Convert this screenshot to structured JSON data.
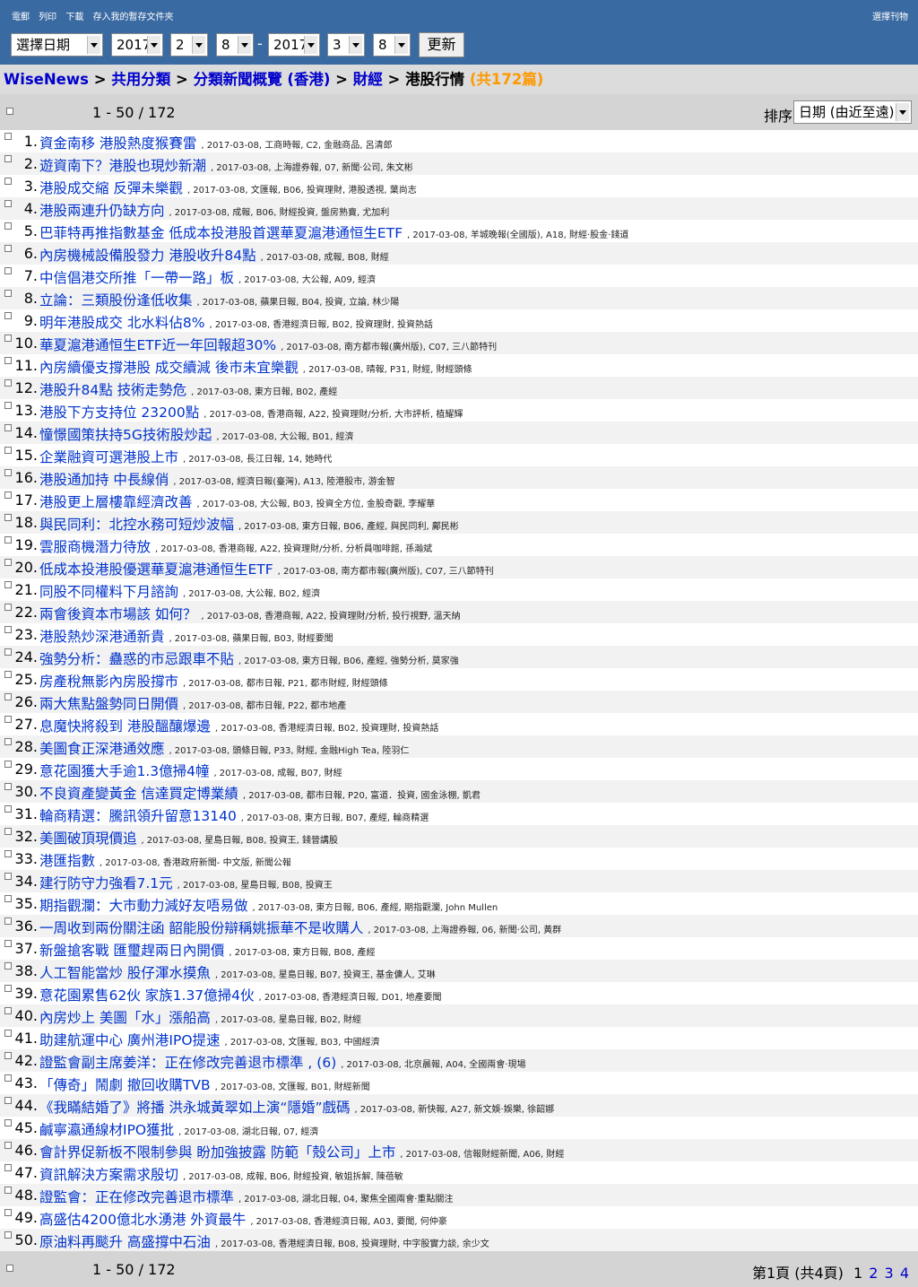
{
  "toolbar": {
    "links": [
      "電郵",
      "列印",
      "下載",
      "存入我的暫存文件夾"
    ],
    "publication_select": "選擇刊物",
    "date_mode": "選擇日期",
    "from": {
      "year": "2017",
      "month": "2",
      "day": "8"
    },
    "separator": "-",
    "to": {
      "year": "2017",
      "month": "3",
      "day": "8"
    },
    "refresh_label": "更新"
  },
  "breadcrumb": {
    "home": "WiseNews",
    "sep": ">",
    "items": [
      "共用分類",
      "分類新聞概覽 (香港)",
      "財經"
    ],
    "current": "港股行情",
    "count": "(共172篇)"
  },
  "list_header": {
    "range": "1 - 50 / 172",
    "sort_label": "排序",
    "sort_value": "日期 (由近至遠)"
  },
  "articles": [
    {
      "num": "1.",
      "title": "資金南移 港股熱度猴賽雷",
      "meta": ", 2017-03-08, 工商時報, C2, 金融商品, 呂清郎"
    },
    {
      "num": "2.",
      "title": "遊資南下？港股也現炒新潮",
      "meta": ", 2017-03-08, 上海證券報, 07, 新聞·公司, 朱文彬"
    },
    {
      "num": "3.",
      "title": "港股成交縮 反彈未樂觀",
      "meta": ", 2017-03-08, 文匯報, B06, 投資理財, 港股透視, 葉尚志"
    },
    {
      "num": "4.",
      "title": "港股兩連升仍缺方向",
      "meta": ", 2017-03-08, 成報, B06, 財經投資, 盤房熟賣, 尤加利"
    },
    {
      "num": "5.",
      "title": "巴菲特再推指數基金 低成本投港股首選華夏滬港通恒生ETF",
      "meta": ", 2017-03-08, 羊城晚報(全國版), A18, 財經·股金·錢道"
    },
    {
      "num": "6.",
      "title": "內房機械設備股發力 港股收升84點",
      "meta": ", 2017-03-08, 成報, B08, 財經"
    },
    {
      "num": "7.",
      "title": "中信倡港交所推「一帶一路」板",
      "meta": ", 2017-03-08, 大公報, A09, 經濟"
    },
    {
      "num": "8.",
      "title": "立論：三類股份逢低收集",
      "meta": ", 2017-03-08, 蘋果日報, B04, 投資, 立論, 林少陽"
    },
    {
      "num": "9.",
      "title": "明年港股成交 北水料佔8%",
      "meta": ", 2017-03-08, 香港經濟日報, B02, 投資理財, 投資熱話"
    },
    {
      "num": "10.",
      "title": "華夏滬港通恒生ETF近一年回報超30%",
      "meta": ", 2017-03-08, 南方都市報(廣州版), C07, 三八節特刊"
    },
    {
      "num": "11.",
      "title": "內房續優支撐港股 成交續減 後市未宜樂觀",
      "meta": ", 2017-03-08, 晴報, P31, 財經, 財經頭條"
    },
    {
      "num": "12.",
      "title": "港股升84點 技術走勢危",
      "meta": ", 2017-03-08, 東方日報, B02, 產經"
    },
    {
      "num": "13.",
      "title": "港股下方支持位 23200點",
      "meta": ", 2017-03-08, 香港商報, A22, 投資理財/分析, 大市評析, 植耀輝"
    },
    {
      "num": "14.",
      "title": "憧憬國策扶持5G技術股炒起",
      "meta": ", 2017-03-08, 大公報, B01, 經濟"
    },
    {
      "num": "15.",
      "title": "企業融資可選港股上市",
      "meta": ", 2017-03-08, 長江日報, 14, 她時代"
    },
    {
      "num": "16.",
      "title": "港股通加持 中長線俏",
      "meta": ", 2017-03-08, 經濟日報(臺灣), A13, 陸港股市, 游金智"
    },
    {
      "num": "17.",
      "title": "港股更上層樓靠經濟改善",
      "meta": ", 2017-03-08, 大公報, B03, 投資全方位, 金股奇觀, 李耀華"
    },
    {
      "num": "18.",
      "title": "與民同利：北控水務可短炒波幅",
      "meta": ", 2017-03-08, 東方日報, B06, 產經, 與民同利, 鄺民彬"
    },
    {
      "num": "19.",
      "title": "雲服商機潛力待放",
      "meta": ", 2017-03-08, 香港商報, A22, 投資理財/分析, 分析員咖啡館, 孫瀚斌"
    },
    {
      "num": "20.",
      "title": "低成本投港股優選華夏滬港通恒生ETF",
      "meta": ", 2017-03-08, 南方都市報(廣州版), C07, 三八節特刊"
    },
    {
      "num": "21.",
      "title": "同股不同權料下月諮詢",
      "meta": ", 2017-03-08, 大公報, B02, 經濟"
    },
    {
      "num": "22.",
      "title": "兩會後資本市場該 如何？",
      "meta": ", 2017-03-08, 香港商報, A22, 投資理財/分析, 投行視野, 溫天納"
    },
    {
      "num": "23.",
      "title": "港股熱炒深港通新貴",
      "meta": ", 2017-03-08, 蘋果日報, B03, 財經要聞"
    },
    {
      "num": "24.",
      "title": "強勢分析：蠱惑的市忌跟車不貼",
      "meta": ", 2017-03-08, 東方日報, B06, 產經, 強勢分析, 莫家強"
    },
    {
      "num": "25.",
      "title": "房產稅無影內房股撐市",
      "meta": ", 2017-03-08, 都市日報, P21, 都市財經, 財經頭條"
    },
    {
      "num": "26.",
      "title": "兩大焦點盤勢同日開價",
      "meta": ", 2017-03-08, 都市日報, P22, 都市地產"
    },
    {
      "num": "27.",
      "title": "息魔快將殺到 港股醞釀爆邊",
      "meta": ", 2017-03-08, 香港經濟日報, B02, 投資理財, 投資熱話"
    },
    {
      "num": "28.",
      "title": "美圖食正深港通效應",
      "meta": ", 2017-03-08, 頭條日報, P33, 財經, 金融High Tea, 陸羽仁"
    },
    {
      "num": "29.",
      "title": "意花園獲大手逾1.3億掃4幢",
      "meta": ", 2017-03-08, 成報, B07, 財經"
    },
    {
      "num": "30.",
      "title": "不良資產變黃金 信達買定博業績",
      "meta": ", 2017-03-08, 都市日報, P20, 富道．投資, 國金泳棚, 凱君"
    },
    {
      "num": "31.",
      "title": "輪商精選：騰訊領升留意13140",
      "meta": ", 2017-03-08, 東方日報, B07, 產經, 輪商精選"
    },
    {
      "num": "32.",
      "title": "美圖破頂現價追",
      "meta": ", 2017-03-08, 星島日報, B08, 投資王, 錢晉講股"
    },
    {
      "num": "33.",
      "title": "港匯指數",
      "meta": ", 2017-03-08, 香港政府新聞- 中文版, 新聞公報"
    },
    {
      "num": "34.",
      "title": "建行防守力強看7.1元",
      "meta": ", 2017-03-08, 星島日報, B08, 投資王"
    },
    {
      "num": "35.",
      "title": "期指觀瀾：大市動力減好友唔易做",
      "meta": ", 2017-03-08, 東方日報, B06, 產經, 期指觀瀾, John Mullen"
    },
    {
      "num": "36.",
      "title": "一周收到兩份關注函 韶能股份辯稱姚振華不是收購人",
      "meta": ", 2017-03-08, 上海證券報, 06, 新聞·公司, 黃群"
    },
    {
      "num": "37.",
      "title": "新盤搶客戰 匯璽趕兩日內開價",
      "meta": ", 2017-03-08, 東方日報, B08, 產經"
    },
    {
      "num": "38.",
      "title": "人工智能當炒 股仔渾水摸魚",
      "meta": ", 2017-03-08, 星島日報, B07, 投資王, 基金傭人, 艾琳"
    },
    {
      "num": "39.",
      "title": "意花園累售62伙 家族1.37億掃4伙",
      "meta": ", 2017-03-08, 香港經濟日報, D01, 地產要聞"
    },
    {
      "num": "40.",
      "title": "內房炒上 美圖「水」漲船高",
      "meta": ", 2017-03-08, 星島日報, B02, 財經"
    },
    {
      "num": "41.",
      "title": "助建航運中心 廣州港IPO提速",
      "meta": ", 2017-03-08, 文匯報, B03, 中國經濟"
    },
    {
      "num": "42.",
      "title": "證監會副主席姜洋：正在修改完善退市標準 , (6)",
      "meta": ", 2017-03-08, 北京晨報, A04, 全國兩會·現場"
    },
    {
      "num": "43.",
      "title": "「傳奇」鬧劇 撤回收購TVB",
      "meta": ", 2017-03-08, 文匯報, B01, 財經新聞"
    },
    {
      "num": "44.",
      "title": "《我瞞結婚了》將播 洪永城黃翠如上演“隱婚”戲碼",
      "meta": ", 2017-03-08, 新快報, A27, 新文娛·娛樂, 徐韶娜"
    },
    {
      "num": "45.",
      "title": "鹹寧瀛通線材IPO獲批",
      "meta": ", 2017-03-08, 湖北日報, 07, 經濟"
    },
    {
      "num": "46.",
      "title": "會計界促新板不限制參與 盼加強披露 防範「殼公司」上市",
      "meta": ", 2017-03-08, 信報財經新聞, A06, 財經"
    },
    {
      "num": "47.",
      "title": "資訊解決方案需求殷切",
      "meta": ", 2017-03-08, 成報, B06, 財經投資, 敏姐拆解, 陳蓓敏"
    },
    {
      "num": "48.",
      "title": "證監會：正在修改完善退市標準",
      "meta": ", 2017-03-08, 湖北日報, 04, 聚焦全國兩會·重點關注"
    },
    {
      "num": "49.",
      "title": "高盛估4200億北水湧港 外資最牛",
      "meta": ", 2017-03-08, 香港經濟日報, A03, 要聞, 何仲豪"
    },
    {
      "num": "50.",
      "title": "原油料再颷升 高盛撐中石油",
      "meta": ", 2017-03-08, 香港經濟日報, B08, 投資理財, 中字股實力談, 余少文"
    }
  ],
  "footer": {
    "range": "1 - 50 / 172",
    "page_text": "第1頁 (共4頁)",
    "pages": [
      "1",
      "2",
      "3",
      "4"
    ]
  }
}
